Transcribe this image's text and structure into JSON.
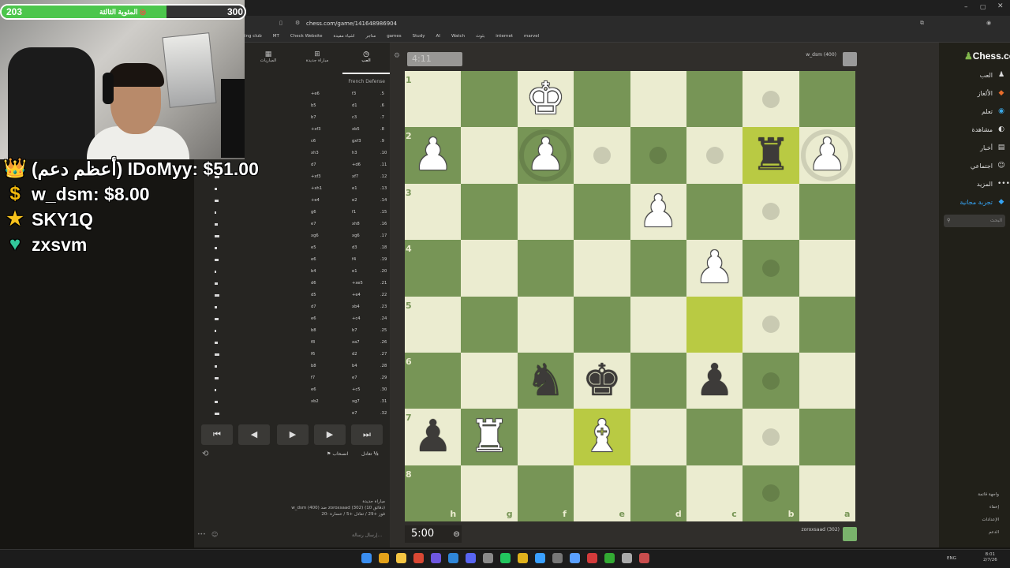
{
  "browser": {
    "url": "chess.com/game/141648986904",
    "bookmarks": [
      "ing club",
      "MT",
      "Check Website",
      "متاجر",
      "اشياء مفيدة",
      "games",
      "Study",
      "AI",
      "Watch",
      "بثوث",
      "internet",
      "marvel"
    ]
  },
  "overlay": {
    "goal_current": "203",
    "goal_target": "300",
    "goal_label": "المئوية الثالثة",
    "goal_progress": 0.677,
    "donations": [
      {
        "icon": "crown-icon",
        "text": "(أعظم دعم) IDoMyy: $51.00",
        "glyph": "👑",
        "color": "#f5b400"
      },
      {
        "icon": "coin-icon",
        "text": "w_dsm: $8.00",
        "glyph": "$",
        "color": "#f2b90d"
      },
      {
        "icon": "star-icon",
        "text": "SKY1Q",
        "glyph": "★",
        "color": "#f7c21c"
      },
      {
        "icon": "heart-icon",
        "text": "zxsvm",
        "glyph": "♥",
        "color": "#32c79a"
      }
    ]
  },
  "left_panel": {
    "tabs": [
      {
        "label": "المباريات",
        "glyph": "▦"
      },
      {
        "label": "مباراة جديدة",
        "glyph": "⊞"
      },
      {
        "label": "العب",
        "glyph": "◷"
      }
    ],
    "opening": "French Defense",
    "moves": [
      {
        "n": ".5",
        "w": "f3",
        "b": "+e6"
      },
      {
        "n": ".6",
        "w": "d1",
        "b": "b5"
      },
      {
        "n": ".7",
        "w": "c3",
        "b": "b7"
      },
      {
        "n": ".8",
        "w": "xb5",
        "b": "+xf3"
      },
      {
        "n": ".9",
        "w": "gxf3",
        "b": "c6"
      },
      {
        "n": ".10",
        "w": "h3",
        "b": "xh3"
      },
      {
        "n": ".11",
        "w": "+d6",
        "b": "d7"
      },
      {
        "n": ".12",
        "w": "xf7",
        "b": "+xf3"
      },
      {
        "n": ".13",
        "w": "e1",
        "b": "+xh1"
      },
      {
        "n": ".14",
        "w": "e2",
        "b": "+e4"
      },
      {
        "n": ".15",
        "w": "f1",
        "b": "g6"
      },
      {
        "n": ".16",
        "w": "xh8",
        "b": "e7"
      },
      {
        "n": ".17",
        "w": "xg6",
        "b": "xg6"
      },
      {
        "n": ".18",
        "w": "d3",
        "b": "e5"
      },
      {
        "n": ".19",
        "w": "f4",
        "b": "e6"
      },
      {
        "n": ".20",
        "w": "e1",
        "b": "b4"
      },
      {
        "n": ".21",
        "w": "+xe5",
        "b": "d6"
      },
      {
        "n": ".22",
        "w": "+e4",
        "b": "d5"
      },
      {
        "n": ".23",
        "w": "xb4",
        "b": "d7"
      },
      {
        "n": ".24",
        "w": "+c4",
        "b": "e6"
      },
      {
        "n": ".25",
        "w": "b7",
        "b": "b8"
      },
      {
        "n": ".26",
        "w": "xa7",
        "b": "f8"
      },
      {
        "n": ".27",
        "w": "d2",
        "b": "f6"
      },
      {
        "n": ".28",
        "w": "b4",
        "b": "b8"
      },
      {
        "n": ".29",
        "w": "e7",
        "b": "f7"
      },
      {
        "n": ".30",
        "w": "+c5",
        "b": "e6"
      },
      {
        "n": ".31",
        "w": "xg7",
        "b": "xb2"
      },
      {
        "n": ".32",
        "w": "e7",
        "b": ""
      }
    ],
    "draw_label": "تعادل",
    "resign_label": "انسحاب",
    "game_info_title": "مباراة جديدة",
    "game_info_line": "w_dsm (400) ضد zoroxsaad (302) (10 دقائق)",
    "game_info_stats": "فوز +29 / تعادل +5 / خسارة -20",
    "chat_placeholder": "إرسال رسالة..."
  },
  "game": {
    "top_timer": "4:11",
    "bottom_timer": "5:00",
    "top_player": "w_dsm (400)",
    "bottom_player": "zoroxsaad (302)",
    "files": [
      "h",
      "g",
      "f",
      "e",
      "d",
      "c",
      "b",
      "a"
    ],
    "ranks": [
      "1",
      "2",
      "3",
      "4",
      "5",
      "6",
      "7",
      "8"
    ],
    "pieces": [
      {
        "sq": "f1",
        "glyph": "♚",
        "color": "white"
      },
      {
        "sq": "h2",
        "glyph": "♟",
        "color": "white"
      },
      {
        "sq": "f2",
        "glyph": "♟",
        "color": "white"
      },
      {
        "sq": "b2",
        "glyph": "♜",
        "color": "black"
      },
      {
        "sq": "a2",
        "glyph": "♟",
        "color": "white"
      },
      {
        "sq": "d3",
        "glyph": "♟",
        "color": "white"
      },
      {
        "sq": "c4",
        "glyph": "♟",
        "color": "white"
      },
      {
        "sq": "f6",
        "glyph": "♞",
        "color": "black"
      },
      {
        "sq": "e6",
        "glyph": "♚",
        "color": "black"
      },
      {
        "sq": "c6",
        "glyph": "♟",
        "color": "black"
      },
      {
        "sq": "h7",
        "glyph": "♟",
        "color": "black"
      },
      {
        "sq": "g7",
        "glyph": "♜",
        "color": "white"
      },
      {
        "sq": "e7",
        "glyph": "♝",
        "color": "white"
      }
    ],
    "highlights": [
      "b2",
      "c5",
      "e7"
    ],
    "dots": [
      "b1",
      "e2",
      "d2",
      "c2",
      "b3",
      "b4",
      "b5",
      "b6",
      "b7",
      "b8"
    ],
    "rings": [
      "f2",
      "a2"
    ]
  },
  "sidebar": {
    "logo": "Chess.com",
    "items": [
      {
        "label": "العب",
        "glyph": "♟",
        "color": "#ddd"
      },
      {
        "label": "الألغاز",
        "glyph": "◆",
        "color": "#e86d2b"
      },
      {
        "label": "تعلم",
        "glyph": "◉",
        "color": "#3aa7e6"
      },
      {
        "label": "مشاهدة",
        "glyph": "◐",
        "color": "#ddd"
      },
      {
        "label": "أخبار",
        "glyph": "▤",
        "color": "#ddd"
      },
      {
        "label": "اجتماعي",
        "glyph": "☺",
        "color": "#ddd"
      },
      {
        "label": "المزيد",
        "glyph": "•••",
        "color": "#ddd"
      },
      {
        "label": "تجربة مجانية",
        "glyph": "◆",
        "color": "#35a3f3"
      }
    ],
    "search_placeholder": "البحث",
    "bottom_items": [
      "واجهة قاتمة",
      "إخفاء",
      "الإعدادات",
      "الدعم"
    ]
  },
  "taskbar": {
    "lang": "ENG",
    "time": "8:01",
    "date": "2/7/26"
  }
}
